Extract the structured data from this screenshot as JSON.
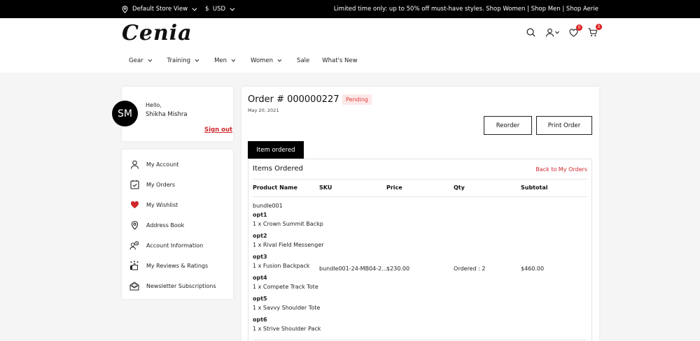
{
  "topbar": {
    "store": "Default Store View",
    "currency": "$  USD",
    "promo": "Limited time only: up to 50% off must-have styles. Shop Women | Shop Men | Shop Aerie"
  },
  "header": {
    "logo": "Cenia",
    "wishlist_count": "0",
    "cart_count": "0",
    "nav": [
      {
        "label": "Gear"
      },
      {
        "label": "Training"
      },
      {
        "label": "Men"
      },
      {
        "label": "Women"
      },
      {
        "label": "Sale"
      },
      {
        "label": "What's New"
      }
    ]
  },
  "account": {
    "initials": "SM",
    "greeting": "Hello,",
    "name": "Shikha Mishra",
    "signout": "Sign out",
    "menu": [
      {
        "label": "My Account",
        "icon": "user-icon"
      },
      {
        "label": "My Orders",
        "icon": "orders-icon"
      },
      {
        "label": "My Wishlist",
        "icon": "heart-icon"
      },
      {
        "label": "Address Book",
        "icon": "location-icon"
      },
      {
        "label": "Account Information",
        "icon": "account-info-icon"
      },
      {
        "label": "My Reviews & Ratings",
        "icon": "reviews-icon"
      },
      {
        "label": "Newsletter Subscriptions",
        "icon": "newsletter-icon"
      }
    ]
  },
  "order": {
    "title": "Order # 000000227",
    "status": "Pending",
    "date": "May 20, 2021",
    "reorder": "Reorder",
    "print": "Print Order",
    "tab": "Item ordered",
    "items_title": "Items Ordered",
    "back_link": "Back to My Orders",
    "columns": [
      "Product Name",
      "SKU",
      "Price",
      "Qty",
      "Subtotal"
    ],
    "item": {
      "name": "bundle001",
      "sku": "bundle001-24-MB04-2...",
      "price": "$230.00",
      "qty": "Ordered : 2",
      "subtotal": "$460.00",
      "options": [
        {
          "title": "opt1",
          "value": "1 x Crown Summit Backp"
        },
        {
          "title": "opt2",
          "value": "1 x Rival Field Messenger"
        },
        {
          "title": "opt3",
          "value": "1 x Fusion Backpack"
        },
        {
          "title": "opt4",
          "value": "1 x Compete Track Tote"
        },
        {
          "title": "opt5",
          "value": "1 x Savvy Shoulder Tote"
        },
        {
          "title": "opt6",
          "value": "1 x Strive Shoulder Pack"
        }
      ]
    }
  },
  "colors": {
    "accent": "#d0262b",
    "status_bg": "#fde8e8",
    "status_text": "#e23b3b"
  }
}
